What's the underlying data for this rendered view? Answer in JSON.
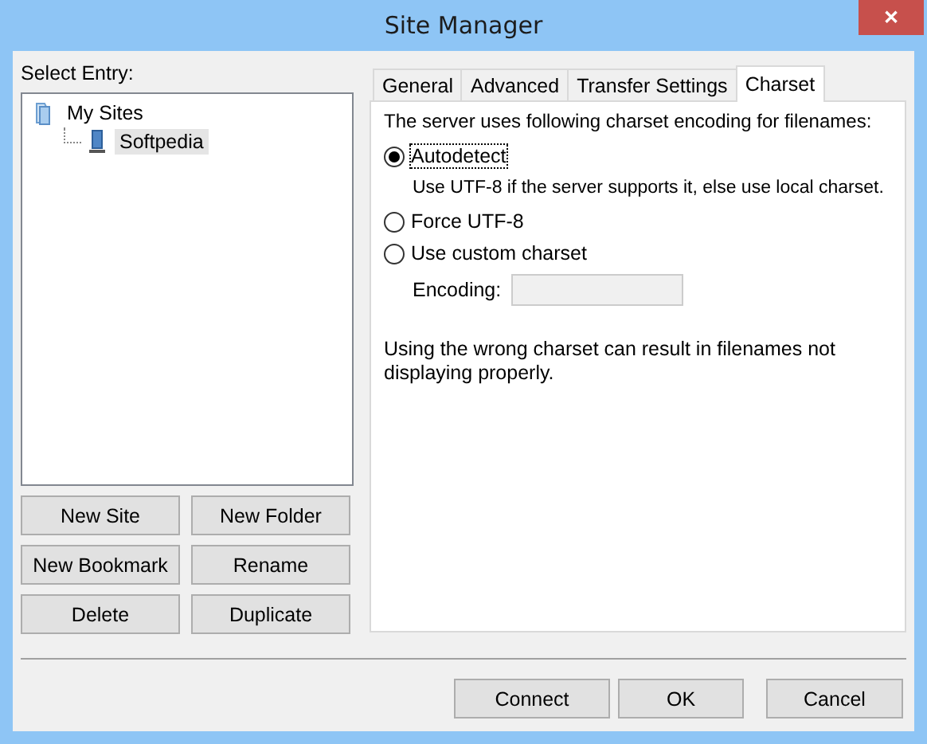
{
  "window": {
    "title": "Site Manager",
    "close": "✕"
  },
  "left": {
    "label": "Select Entry:",
    "tree": [
      {
        "label": "My Sites",
        "kind": "folder",
        "selected": false,
        "children": [
          {
            "label": "Softpedia",
            "kind": "site",
            "selected": true
          }
        ]
      }
    ],
    "buttons": [
      "New Site",
      "New Folder",
      "New Bookmark",
      "Rename",
      "Delete",
      "Duplicate"
    ]
  },
  "tabs": [
    {
      "label": "General",
      "selected": false
    },
    {
      "label": "Advanced",
      "selected": false
    },
    {
      "label": "Transfer Settings",
      "selected": false
    },
    {
      "label": "Charset",
      "selected": true
    }
  ],
  "charset": {
    "intro": "The server uses following charset encoding for filenames:",
    "options": [
      {
        "label": "Autodetect",
        "selected": true,
        "focused": true,
        "note": "Use UTF-8 if the server supports it, else use local charset."
      },
      {
        "label": "Force UTF-8",
        "selected": false,
        "focused": false
      },
      {
        "label": "Use custom charset",
        "selected": false,
        "focused": false
      }
    ],
    "encoding": {
      "label": "Encoding:",
      "disabled": true
    },
    "warning": "Using the wrong charset can result in filenames not displaying properly."
  },
  "footer": [
    "Connect",
    "OK",
    "Cancel"
  ]
}
